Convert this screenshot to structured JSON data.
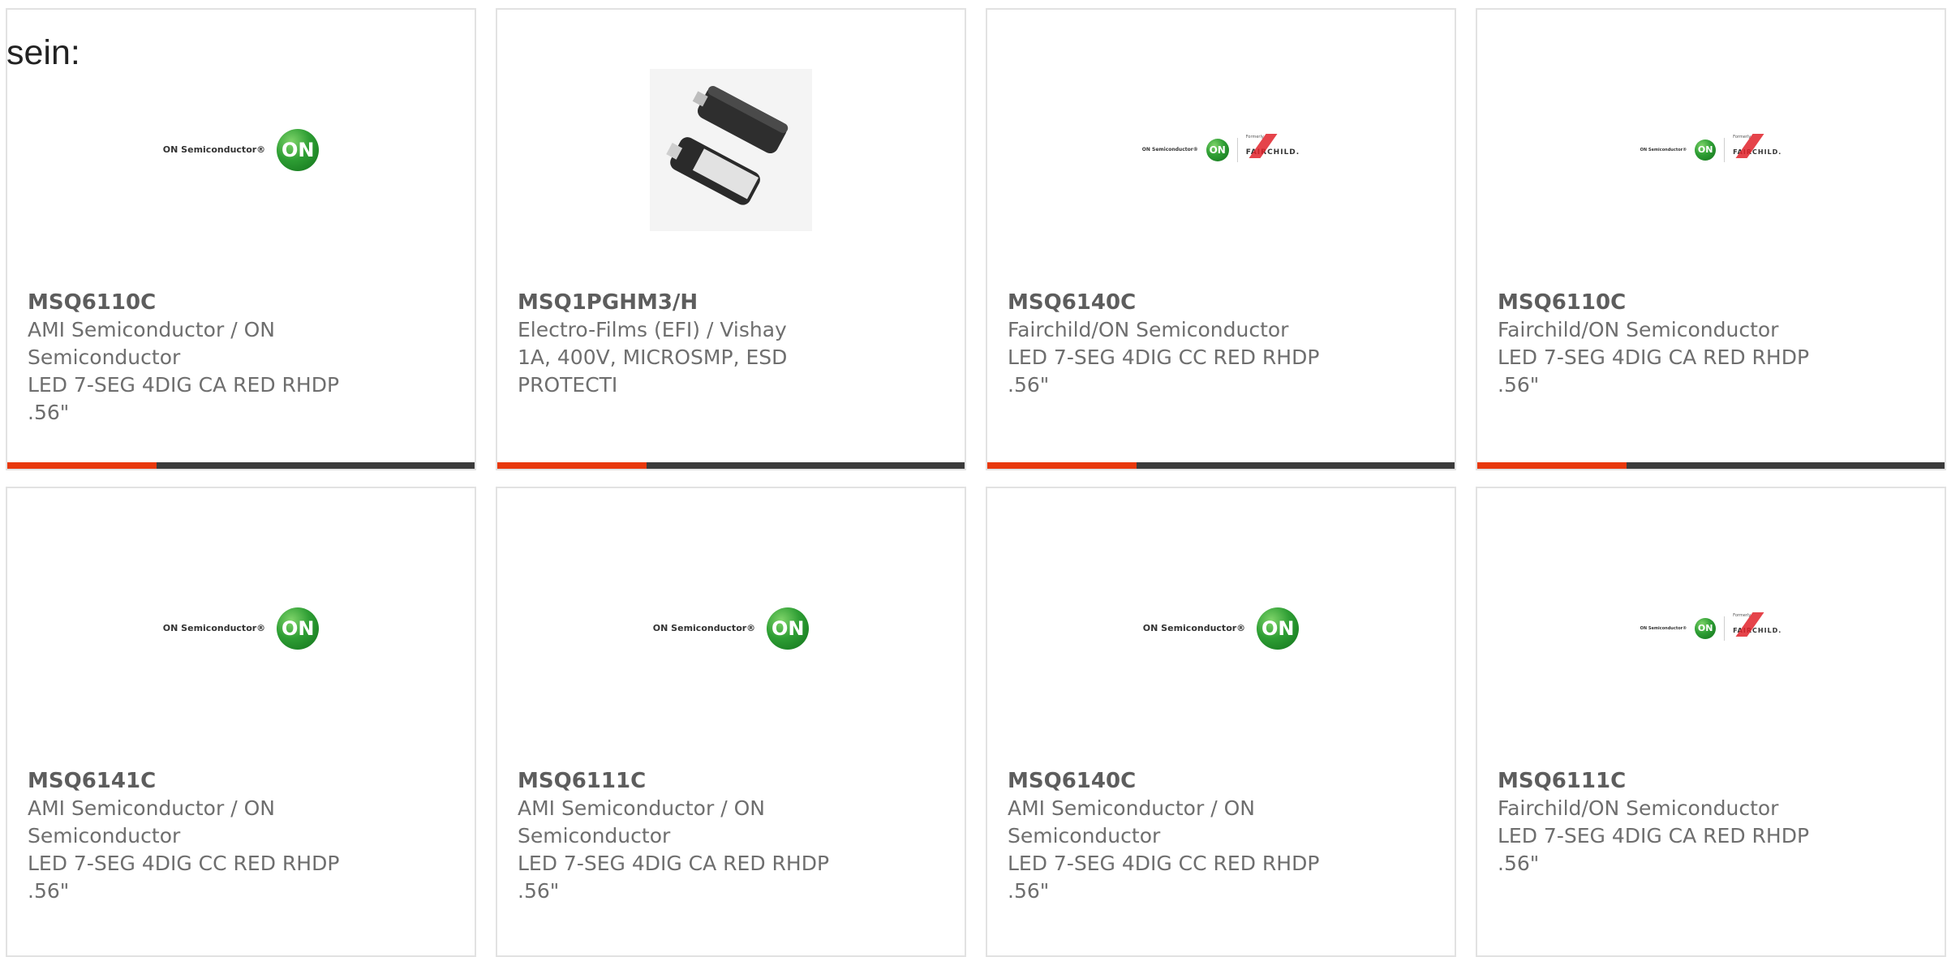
{
  "lead_text": "sein:",
  "colors": {
    "accent": "#e8380d",
    "bar": "#3a3a3a",
    "on_green": "#2e9e34",
    "fairchild_red": "#e0222a"
  },
  "products": [
    {
      "part": "MSQ6110C",
      "lines": [
        "AMI Semiconductor / ON",
        "Semiconductor",
        "LED 7-SEG 4DIG CA RED RHDP",
        ".56\""
      ],
      "image": "on-semiconductor-logo"
    },
    {
      "part": "MSQ1PGHM3/H",
      "lines": [
        "Electro-Films (EFI) / Vishay",
        "1A, 400V, MICROSMP, ESD",
        "PROTECTI"
      ],
      "image": "smd-package-photo"
    },
    {
      "part": "MSQ6140C",
      "lines": [
        "Fairchild/ON Semiconductor",
        "LED 7-SEG 4DIG CC RED RHDP",
        ".56\""
      ],
      "image": "on-fairchild-logo"
    },
    {
      "part": "MSQ6110C",
      "lines": [
        "Fairchild/ON Semiconductor",
        "LED 7-SEG 4DIG CA RED RHDP",
        ".56\""
      ],
      "image": "on-fairchild-logo"
    },
    {
      "part": "MSQ6141C",
      "lines": [
        "AMI Semiconductor / ON",
        "Semiconductor",
        "LED 7-SEG 4DIG CC RED RHDP",
        ".56\""
      ],
      "image": "on-semiconductor-logo"
    },
    {
      "part": "MSQ6111C",
      "lines": [
        "AMI Semiconductor / ON",
        "Semiconductor",
        "LED 7-SEG 4DIG CA RED RHDP",
        ".56\""
      ],
      "image": "on-semiconductor-logo"
    },
    {
      "part": "MSQ6140C",
      "lines": [
        "AMI Semiconductor / ON",
        "Semiconductor",
        "LED 7-SEG 4DIG CC RED RHDP",
        ".56\""
      ],
      "image": "on-semiconductor-logo"
    },
    {
      "part": "MSQ6111C",
      "lines": [
        "Fairchild/ON Semiconductor",
        "LED 7-SEG 4DIG CA RED RHDP",
        ".56\""
      ],
      "image": "on-fairchild-logo"
    }
  ],
  "logos": {
    "on_text": "ON Semiconductor®",
    "on_mark": "ON",
    "formerly": "Formerly",
    "fairchild": "FAIRCHILD."
  }
}
